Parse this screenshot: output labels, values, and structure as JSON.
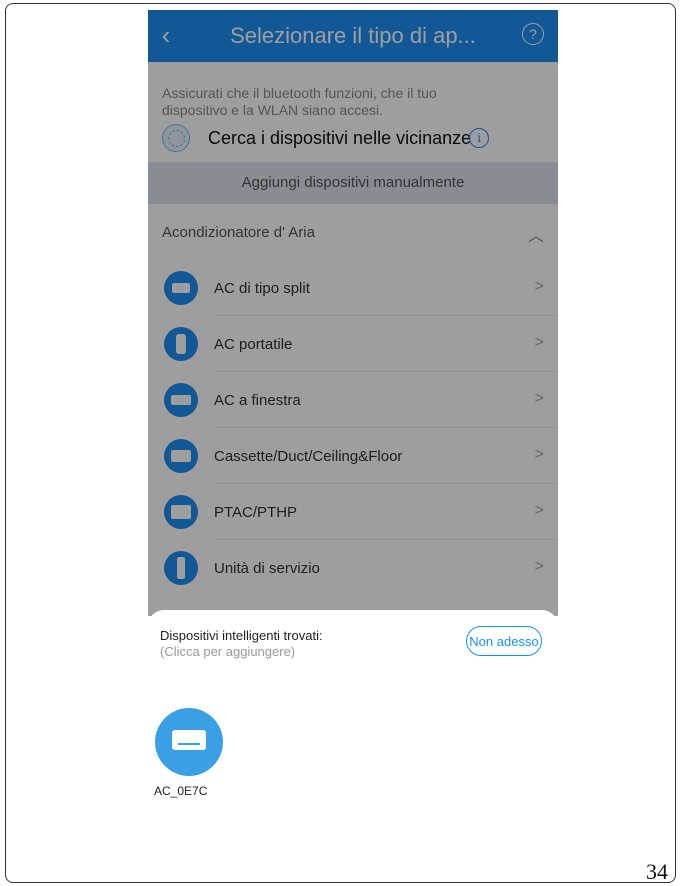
{
  "header": {
    "back_icon": "chevron-left-icon",
    "title": "Selezionare il tipo di ap...",
    "help_icon": "question-circle-icon"
  },
  "info": {
    "description": "Assicurati che il bluetooth funzioni, che il tuo dispositivo e la WLAN siano accesi.",
    "search_label": "Cerca i dispositivi nelle vicinanze",
    "search_icon": "radar-icon",
    "info_icon": "info-circle-icon"
  },
  "add_manual": {
    "label": "Aggiungi dispositivi manualmente"
  },
  "category": {
    "label": "Acondizionatore d' Aria",
    "collapse_icon": "chevron-up-icon"
  },
  "items": [
    {
      "label": "AC di tipo split",
      "icon": "split-ac-icon"
    },
    {
      "label": "AC portatile",
      "icon": "portable-ac-icon"
    },
    {
      "label": "AC a finestra",
      "icon": "window-ac-icon"
    },
    {
      "label": "Cassette/Duct/Ceiling&Floor",
      "icon": "cassette-ac-icon"
    },
    {
      "label": "PTAC/PTHP",
      "icon": "ptac-icon"
    },
    {
      "label": "Unità di servizio",
      "icon": "service-unit-icon"
    }
  ],
  "sheet": {
    "title": "Dispositivi intelligenti trovati:",
    "subtitle": "(Clicca per aggiungere)",
    "later_button": "Non adesso",
    "device_name": "AC_0E7C",
    "device_icon": "air-conditioner-icon"
  },
  "page_number": "34",
  "colors": {
    "accent": "#1e8ff2",
    "device_circle": "#3b9fe6"
  }
}
